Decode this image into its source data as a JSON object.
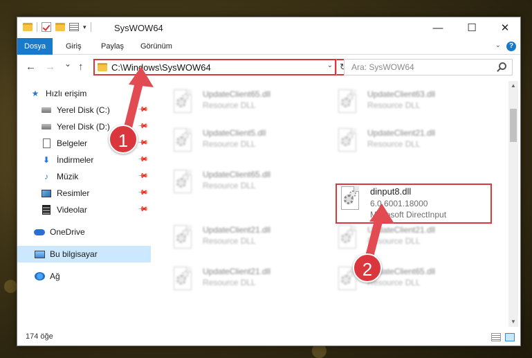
{
  "window": {
    "title": "SysWOW64",
    "controls": {
      "minimize": "—",
      "maximize": "☐",
      "close": "✕"
    }
  },
  "ribbon": {
    "tabs": [
      "Dosya",
      "Giriş",
      "Paylaş",
      "Görünüm"
    ],
    "help": "?"
  },
  "nav": {
    "back": "←",
    "forward": "→",
    "recent": "⌄",
    "up": "↑",
    "address": "C:\\Windows\\SysWOW64",
    "refresh": "↻",
    "search_placeholder": "Ara: SysWOW64"
  },
  "sidebar": {
    "items": [
      {
        "label": "Hızlı erişim",
        "icon": "star-icon"
      },
      {
        "label": "Yerel Disk (C:)",
        "icon": "drive-icon",
        "pinned": true
      },
      {
        "label": "Yerel Disk (D:)",
        "icon": "drive-icon",
        "pinned": true
      },
      {
        "label": "Belgeler",
        "icon": "document-icon",
        "pinned": true
      },
      {
        "label": "İndirmeler",
        "icon": "download-icon",
        "pinned": true
      },
      {
        "label": "Müzik",
        "icon": "music-icon",
        "pinned": true
      },
      {
        "label": "Resimler",
        "icon": "pictures-icon",
        "pinned": true
      },
      {
        "label": "Videolar",
        "icon": "videos-icon",
        "pinned": true
      },
      {
        "label": "OneDrive",
        "icon": "cloud-icon"
      },
      {
        "label": "Bu bilgisayar",
        "icon": "computer-icon",
        "selected": true
      },
      {
        "label": "Ağ",
        "icon": "network-icon"
      }
    ]
  },
  "files": [
    {
      "name": "UpdateClient65.dll",
      "sub1": "Resource DLL",
      "blurred": true
    },
    {
      "name": "UpdateClient63.dll",
      "sub1": "Resource DLL",
      "blurred": true
    },
    {
      "name": "UpdateClient5.dll",
      "sub1": "Resource DLL",
      "blurred": true
    },
    {
      "name": "UpdateClient21.dll",
      "sub1": "Resource DLL",
      "blurred": true
    },
    {
      "name": "UpdateClient65.dll",
      "sub1": "Resource DLL",
      "blurred": true
    },
    {
      "name": "dinput8.dll",
      "sub1": "6.0.6001.18000",
      "sub2": "Microsoft DirectInput",
      "blurred": false
    },
    {
      "name": "UpdateClient21.dll",
      "sub1": "Resource DLL",
      "blurred": true
    },
    {
      "name": "UpdateClient21.dll",
      "sub1": "Resource DLL",
      "blurred": true
    },
    {
      "name": "UpdateClient21.dll",
      "sub1": "Resource DLL",
      "blurred": true
    },
    {
      "name": "UpdateClient65.dll",
      "sub1": "Resource DLL",
      "blurred": true
    }
  ],
  "status": {
    "count": "174 öğe"
  },
  "annotations": {
    "step1": "1",
    "step2": "2"
  },
  "colors": {
    "accent": "#1979ca",
    "highlight": "#d9363e",
    "selected": "#cce8ff"
  }
}
